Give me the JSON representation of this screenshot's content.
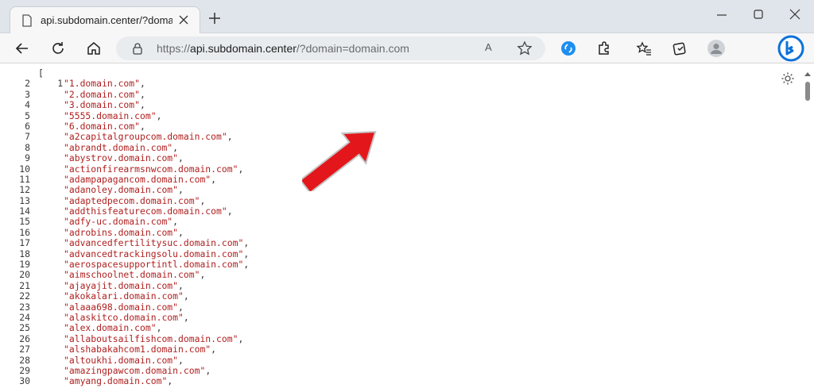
{
  "tab": {
    "title": "api.subdomain.center/?domain=",
    "favicon": "page-icon"
  },
  "toolbar": {
    "back_icon": "back-arrow-icon",
    "refresh_icon": "refresh-icon",
    "home_icon": "home-icon"
  },
  "address_bar": {
    "scheme": "https://",
    "host": "api.subdomain.center",
    "path": "/?domain=domain.com",
    "read_aloud_label": "A",
    "favorite_icon": "star-icon"
  },
  "extensions": [
    "shazam-icon",
    "puzzle-icon",
    "favorites-icon",
    "collections-icon",
    "profile-icon",
    "bing-icon"
  ],
  "json_view": {
    "open_bracket": "[",
    "line_numbers": [
      "1",
      "2",
      "3",
      "4",
      "5",
      "6",
      "7",
      "8",
      "9",
      "10",
      "11",
      "12",
      "13",
      "14",
      "15",
      "16",
      "17",
      "18",
      "19",
      "20",
      "21",
      "22",
      "23",
      "24",
      "25",
      "26",
      "27",
      "28",
      "29",
      "30"
    ],
    "entries": [
      "\"1.domain.com\"",
      "\"2.domain.com\"",
      "\"3.domain.com\"",
      "\"5555.domain.com\"",
      "\"6.domain.com\"",
      "\"a2capitalgroupcom.domain.com\"",
      "\"abrandt.domain.com\"",
      "\"abystrov.domain.com\"",
      "\"actionfirearmsnwcom.domain.com\"",
      "\"adampapagancom.domain.com\"",
      "\"adanoley.domain.com\"",
      "\"adaptedpecom.domain.com\"",
      "\"addthisfeaturecom.domain.com\"",
      "\"adfy-uc.domain.com\"",
      "\"adrobins.domain.com\"",
      "\"advancedfertilitysuc.domain.com\"",
      "\"advancedtrackingsolu.domain.com\"",
      "\"aerospacesupportintl.domain.com\"",
      "\"aimschoolnet.domain.com\"",
      "\"ajayajit.domain.com\"",
      "\"akokalari.domain.com\"",
      "\"alaaa698.domain.com\"",
      "\"alaskitco.domain.com\"",
      "\"alex.domain.com\"",
      "\"allaboutsailfishcom.domain.com\"",
      "\"alshabakahcom1.domain.com\"",
      "\"altoukhi.domain.com\"",
      "\"amazingpawcom.domain.com\"",
      "\"amyang.domain.com\""
    ],
    "separator": ","
  },
  "colors": {
    "string": "#b01f1f",
    "arrow": "#e3161b",
    "accent": "#0b72d9"
  }
}
